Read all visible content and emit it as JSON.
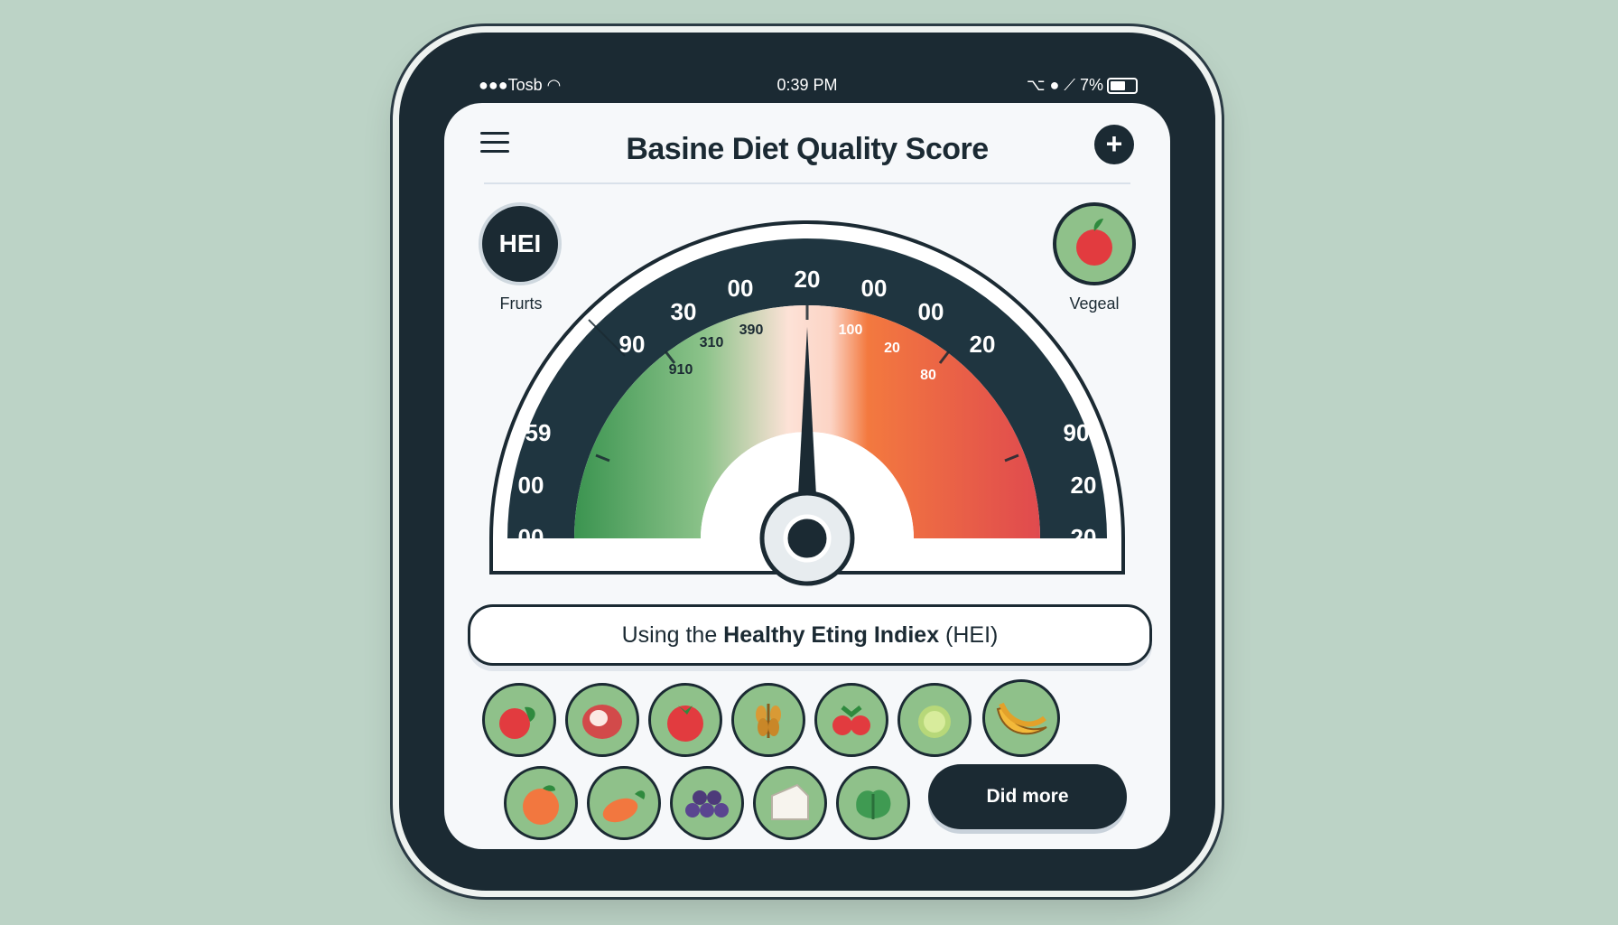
{
  "status": {
    "carrier": "●●●Tosb",
    "time": "0:39 PM",
    "indicators": "⌥ ● ⟋ 7%",
    "wifi_icon": "wifi-icon"
  },
  "header": {
    "title": "Basine Diet Quality Score",
    "menu_icon": "hamburger-icon",
    "add_label": "+"
  },
  "side": {
    "left_badge": "HEI",
    "left_label": "Frurts",
    "right_label": "Vegeal"
  },
  "gauge": {
    "outer_left_labels": [
      "00",
      "00",
      "59"
    ],
    "outer_right_labels": [
      "20",
      "20",
      "90"
    ],
    "top_arc_labels": [
      "90",
      "30",
      "00",
      "20",
      "00",
      "00",
      "20"
    ],
    "inner_labels": [
      "910",
      "310",
      "390",
      "100",
      "20",
      "80"
    ],
    "needle_value": "20"
  },
  "banner": {
    "prefix": "Using the ",
    "bold": "Healthy Eting Indiex",
    "suffix": " (HEI)"
  },
  "foods": [
    "apple-icon",
    "onion-icon",
    "tomato-icon",
    "grain-icon",
    "berries-icon",
    "lime-icon",
    "banana-icon",
    "orange-icon",
    "carrot-icon",
    "grapes-icon",
    "tofu-icon",
    "lettuce-icon"
  ],
  "more_button": "Did more",
  "colors": {
    "dark": "#1b2a33",
    "green": "#3f9a52",
    "light_green": "#8fc18a",
    "peach": "#fcd8cc",
    "orange": "#f2773f",
    "red": "#df4b4f",
    "background": "#bcd3c6"
  }
}
